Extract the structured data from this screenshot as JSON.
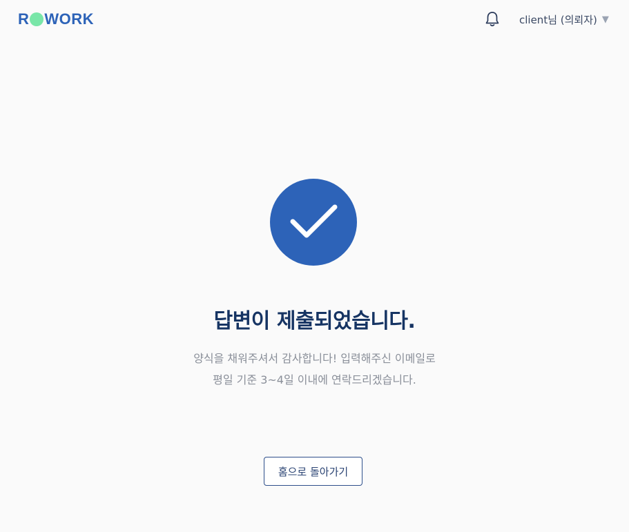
{
  "header": {
    "logo_left": "R",
    "logo_right": "WORK",
    "user_label": "client님 (의뢰자)",
    "caret": "▼"
  },
  "icons": {
    "notification": "bell-icon",
    "status": "check-icon"
  },
  "colors": {
    "brand": "#2d63b8",
    "logo_dot": "#79e6a8",
    "title": "#163463",
    "muted_text": "#8a8f99"
  },
  "main": {
    "title": "답변이 제출되었습니다.",
    "description_line1": "양식을 채워주셔서 감사합니다! 입력해주신 이메일로",
    "description_line2": "평일 기준 3~4일 이내에 연락드리겠습니다.",
    "home_button": "홈으로 돌아가기"
  }
}
